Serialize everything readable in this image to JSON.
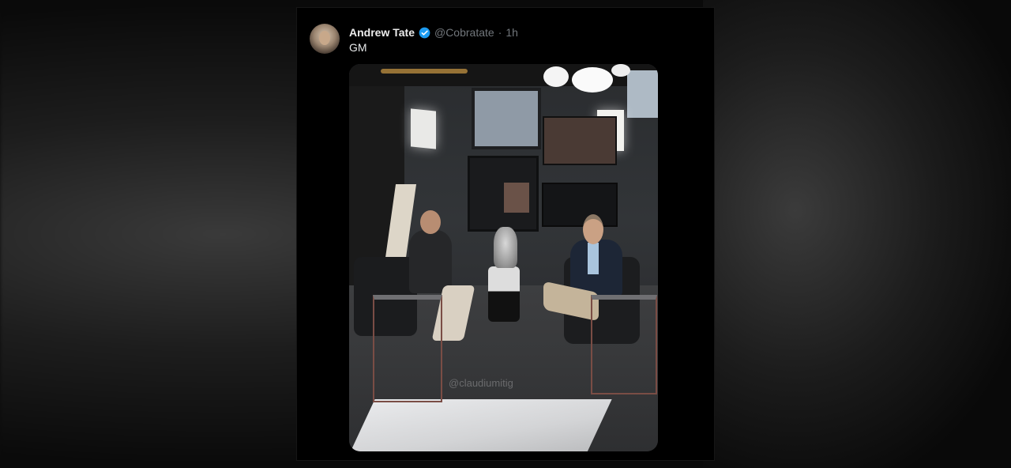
{
  "tweet": {
    "display_name": "Andrew Tate",
    "handle": "@Cobratate",
    "separator": "·",
    "time": "1h",
    "text": "GM",
    "verified_color": "#1d9bf0"
  },
  "photo": {
    "watermark": "@claudiumitig"
  },
  "icons": {
    "verified": "verified-badge-icon"
  }
}
